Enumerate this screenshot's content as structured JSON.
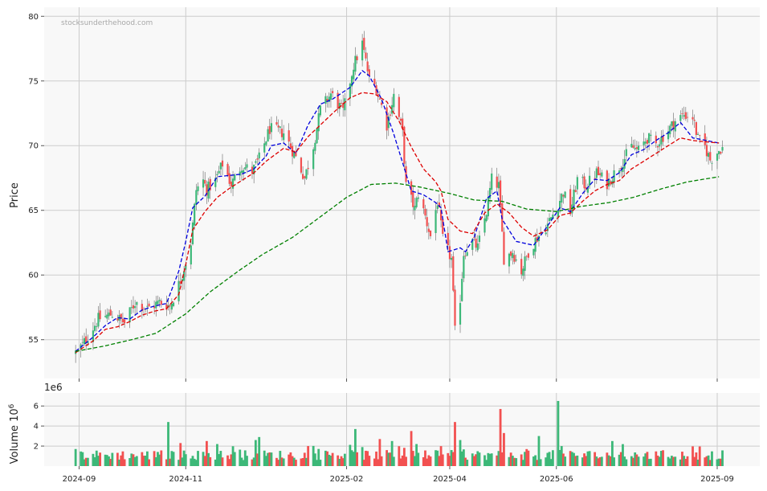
{
  "chart_data": [
    {
      "type": "candlestick",
      "watermark": "stocksunderthehood.com",
      "ylabel": "Price",
      "ylim": [
        52,
        80.7
      ],
      "y_ticks": [
        55,
        60,
        65,
        70,
        75,
        80
      ],
      "colors": {
        "up": "#3cb878",
        "down": "#f25050",
        "ma_short": "#0000dd",
        "ma_mid": "#dd0000",
        "ma_long": "#008000"
      },
      "series": [
        {
          "type": "line",
          "style": "dashed",
          "points": [
            [
              "2024-08-30",
              54.1
            ],
            [
              "2024-09-09",
              55.2
            ],
            [
              "2024-09-16",
              56.1
            ],
            [
              "2024-09-23",
              56.7
            ],
            [
              "2024-09-30",
              56.6
            ],
            [
              "2024-10-07",
              57.3
            ],
            [
              "2024-10-14",
              57.6
            ],
            [
              "2024-10-21",
              57.8
            ],
            [
              "2024-10-28",
              60.3
            ],
            [
              "2024-11-01",
              62.6
            ],
            [
              "2024-11-05",
              65.2
            ],
            [
              "2024-11-12",
              66.1
            ],
            [
              "2024-11-19",
              67.6
            ],
            [
              "2024-11-26",
              67.7
            ],
            [
              "2024-12-03",
              67.8
            ],
            [
              "2024-12-10",
              68.2
            ],
            [
              "2024-12-17",
              69.2
            ],
            [
              "2024-12-20",
              70.0
            ],
            [
              "2024-12-27",
              70.2
            ],
            [
              "2025-01-03",
              69.4
            ],
            [
              "2025-01-10",
              71.6
            ],
            [
              "2025-01-17",
              73.2
            ],
            [
              "2025-01-24",
              73.6
            ],
            [
              "2025-02-03",
              74.5
            ],
            [
              "2025-02-10",
              75.8
            ],
            [
              "2025-02-14",
              75.4
            ],
            [
              "2025-02-21",
              73.6
            ],
            [
              "2025-02-28",
              70.9
            ],
            [
              "2025-03-05",
              68.7
            ],
            [
              "2025-03-10",
              66.5
            ],
            [
              "2025-03-17",
              66.2
            ],
            [
              "2025-03-24",
              65.6
            ],
            [
              "2025-03-27",
              65.2
            ],
            [
              "2025-03-31",
              61.8
            ],
            [
              "2025-04-07",
              62.1
            ],
            [
              "2025-04-10",
              61.8
            ],
            [
              "2025-04-15",
              62.9
            ],
            [
              "2025-04-22",
              65.9
            ],
            [
              "2025-04-28",
              66.5
            ],
            [
              "2025-05-01",
              64.3
            ],
            [
              "2025-05-09",
              62.6
            ],
            [
              "2025-05-19",
              62.3
            ],
            [
              "2025-05-27",
              63.8
            ],
            [
              "2025-06-03",
              65.2
            ],
            [
              "2025-06-09",
              64.9
            ],
            [
              "2025-06-16",
              66.3
            ],
            [
              "2025-06-23",
              67.4
            ],
            [
              "2025-06-30",
              67.3
            ],
            [
              "2025-07-07",
              67.9
            ],
            [
              "2025-07-14",
              69.3
            ],
            [
              "2025-07-21",
              69.7
            ],
            [
              "2025-07-28",
              70.4
            ],
            [
              "2025-08-04",
              71.0
            ],
            [
              "2025-08-11",
              71.8
            ],
            [
              "2025-08-18",
              70.6
            ],
            [
              "2025-08-22",
              70.5
            ],
            [
              "2025-09-02",
              70.2
            ]
          ]
        },
        {
          "type": "line",
          "style": "dashed",
          "points": [
            [
              "2024-08-30",
              54.0
            ],
            [
              "2024-09-09",
              54.9
            ],
            [
              "2024-09-16",
              55.8
            ],
            [
              "2024-09-23",
              56.0
            ],
            [
              "2024-09-30",
              56.4
            ],
            [
              "2024-10-07",
              56.9
            ],
            [
              "2024-10-14",
              57.2
            ],
            [
              "2024-10-21",
              57.4
            ],
            [
              "2024-10-28",
              58.5
            ],
            [
              "2024-11-01",
              60.8
            ],
            [
              "2024-11-05",
              63.5
            ],
            [
              "2024-11-12",
              64.9
            ],
            [
              "2024-11-19",
              66.0
            ],
            [
              "2024-11-26",
              66.7
            ],
            [
              "2024-12-03",
              67.3
            ],
            [
              "2024-12-10",
              67.9
            ],
            [
              "2024-12-17",
              68.8
            ],
            [
              "2024-12-27",
              69.8
            ],
            [
              "2025-01-03",
              69.5
            ],
            [
              "2025-01-10",
              70.7
            ],
            [
              "2025-01-17",
              71.6
            ],
            [
              "2025-01-24",
              72.5
            ],
            [
              "2025-02-03",
              73.7
            ],
            [
              "2025-02-10",
              74.1
            ],
            [
              "2025-02-17",
              74.0
            ],
            [
              "2025-02-24",
              73.4
            ],
            [
              "2025-03-03",
              71.9
            ],
            [
              "2025-03-10",
              69.9
            ],
            [
              "2025-03-17",
              68.2
            ],
            [
              "2025-03-24",
              67.2
            ],
            [
              "2025-03-27",
              66.5
            ],
            [
              "2025-03-31",
              64.3
            ],
            [
              "2025-04-07",
              63.4
            ],
            [
              "2025-04-14",
              63.2
            ],
            [
              "2025-04-21",
              64.8
            ],
            [
              "2025-04-28",
              65.5
            ],
            [
              "2025-05-05",
              64.8
            ],
            [
              "2025-05-12",
              63.7
            ],
            [
              "2025-05-19",
              63.0
            ],
            [
              "2025-05-27",
              63.5
            ],
            [
              "2025-06-03",
              64.6
            ],
            [
              "2025-06-09",
              64.8
            ],
            [
              "2025-06-16",
              65.7
            ],
            [
              "2025-06-23",
              66.5
            ],
            [
              "2025-06-30",
              67.0
            ],
            [
              "2025-07-07",
              67.3
            ],
            [
              "2025-07-14",
              68.2
            ],
            [
              "2025-07-21",
              68.8
            ],
            [
              "2025-07-28",
              69.4
            ],
            [
              "2025-08-04",
              70.0
            ],
            [
              "2025-08-11",
              70.6
            ],
            [
              "2025-08-18",
              70.4
            ],
            [
              "2025-08-25",
              70.3
            ],
            [
              "2025-09-02",
              70.2
            ]
          ]
        },
        {
          "type": "line",
          "style": "dashed",
          "points": [
            [
              "2024-08-30",
              54.1
            ],
            [
              "2024-09-15",
              54.5
            ],
            [
              "2024-10-01",
              55.0
            ],
            [
              "2024-10-15",
              55.5
            ],
            [
              "2024-11-01",
              57.0
            ],
            [
              "2024-11-15",
              58.7
            ],
            [
              "2024-12-01",
              60.3
            ],
            [
              "2024-12-15",
              61.6
            ],
            [
              "2025-01-01",
              62.9
            ],
            [
              "2025-01-15",
              64.3
            ],
            [
              "2025-02-01",
              66.0
            ],
            [
              "2025-02-15",
              67.0
            ],
            [
              "2025-03-01",
              67.1
            ],
            [
              "2025-03-15",
              66.8
            ],
            [
              "2025-04-01",
              66.3
            ],
            [
              "2025-04-15",
              65.8
            ],
            [
              "2025-05-01",
              65.7
            ],
            [
              "2025-05-15",
              65.1
            ],
            [
              "2025-06-01",
              64.9
            ],
            [
              "2025-06-15",
              65.3
            ],
            [
              "2025-07-01",
              65.6
            ],
            [
              "2025-07-15",
              66.0
            ],
            [
              "2025-08-01",
              66.7
            ],
            [
              "2025-08-15",
              67.2
            ],
            [
              "2025-09-02",
              67.6
            ]
          ]
        }
      ],
      "anchors": [
        [
          "2024-08-30",
          54.0
        ],
        [
          "2024-09-03",
          54.6
        ],
        [
          "2024-09-12",
          56.6
        ],
        [
          "2024-09-20",
          57.0
        ],
        [
          "2024-09-27",
          56.3
        ],
        [
          "2024-10-03",
          57.9
        ],
        [
          "2024-10-10",
          57.4
        ],
        [
          "2024-10-17",
          57.9
        ],
        [
          "2024-10-23",
          57.6
        ],
        [
          "2024-10-29",
          59.6
        ],
        [
          "2024-11-04",
          62.5
        ],
        [
          "2024-11-07",
          66.6
        ],
        [
          "2024-11-11",
          67.3
        ],
        [
          "2024-11-13",
          66.6
        ],
        [
          "2024-11-18",
          67.3
        ],
        [
          "2024-11-22",
          68.6
        ],
        [
          "2024-11-27",
          67.0
        ],
        [
          "2024-12-03",
          68.5
        ],
        [
          "2024-12-09",
          68.0
        ],
        [
          "2024-12-13",
          69.0
        ],
        [
          "2024-12-19",
          71.3
        ],
        [
          "2024-12-27",
          71.0
        ],
        [
          "2025-01-03",
          69.1
        ],
        [
          "2025-01-08",
          67.5
        ],
        [
          "2025-01-13",
          70.0
        ],
        [
          "2025-01-17",
          72.8
        ],
        [
          "2025-01-23",
          74.0
        ],
        [
          "2025-01-30",
          72.6
        ],
        [
          "2025-02-05",
          76.2
        ],
        [
          "2025-02-10",
          77.9
        ],
        [
          "2025-02-14",
          75.1
        ],
        [
          "2025-02-18",
          74.5
        ],
        [
          "2025-02-24",
          71.6
        ],
        [
          "2025-02-28",
          73.9
        ],
        [
          "2025-03-05",
          71.0
        ],
        [
          "2025-03-07",
          66.9
        ],
        [
          "2025-03-12",
          65.1
        ],
        [
          "2025-03-14",
          66.3
        ],
        [
          "2025-03-18",
          64.5
        ],
        [
          "2025-03-21",
          63.0
        ],
        [
          "2025-03-25",
          65.7
        ],
        [
          "2025-03-28",
          62.8
        ],
        [
          "2025-04-02",
          61.2
        ],
        [
          "2025-04-04",
          55.6
        ],
        [
          "2025-04-07",
          58.2
        ],
        [
          "2025-04-09",
          61.7
        ],
        [
          "2025-04-14",
          62.6
        ],
        [
          "2025-04-17",
          62.1
        ],
        [
          "2025-04-22",
          64.9
        ],
        [
          "2025-04-25",
          67.4
        ],
        [
          "2025-04-29",
          66.9
        ],
        [
          "2025-05-02",
          61.3
        ],
        [
          "2025-05-07",
          61.8
        ],
        [
          "2025-05-12",
          60.3
        ],
        [
          "2025-05-16",
          61.8
        ],
        [
          "2025-05-21",
          62.9
        ],
        [
          "2025-05-27",
          63.9
        ],
        [
          "2025-06-02",
          65.5
        ],
        [
          "2025-06-05",
          66.4
        ],
        [
          "2025-06-09",
          64.9
        ],
        [
          "2025-06-13",
          67.4
        ],
        [
          "2025-06-18",
          66.9
        ],
        [
          "2025-06-24",
          67.9
        ],
        [
          "2025-06-30",
          67.1
        ],
        [
          "2025-07-07",
          68.4
        ],
        [
          "2025-07-14",
          69.9
        ],
        [
          "2025-07-18",
          69.6
        ],
        [
          "2025-07-23",
          70.6
        ],
        [
          "2025-07-28",
          70.1
        ],
        [
          "2025-08-04",
          71.2
        ],
        [
          "2025-08-08",
          71.9
        ],
        [
          "2025-08-13",
          72.4
        ],
        [
          "2025-08-18",
          72.2
        ],
        [
          "2025-08-21",
          70.5
        ],
        [
          "2025-08-25",
          69.9
        ],
        [
          "2025-08-28",
          68.9
        ],
        [
          "2025-09-03",
          69.8
        ]
      ]
    },
    {
      "type": "bar",
      "ylabel": "Volume  10",
      "ylabel_exp": "6",
      "offset_text": "1e6",
      "ylim": [
        0,
        7.3
      ],
      "y_ticks": [
        2,
        4,
        6
      ],
      "colors": {
        "up": "#3cb878",
        "down": "#f25050"
      },
      "spikes": [
        [
          "2024-10-22",
          4.4
        ],
        [
          "2024-10-29",
          2.3
        ],
        [
          "2024-11-13",
          2.5
        ],
        [
          "2024-11-19",
          2.2
        ],
        [
          "2024-12-11",
          2.6
        ],
        [
          "2024-12-13",
          2.9
        ],
        [
          "2025-01-10",
          2.0
        ],
        [
          "2025-02-06",
          3.7
        ],
        [
          "2025-02-10",
          1.9
        ],
        [
          "2025-02-20",
          2.7
        ],
        [
          "2025-02-27",
          2.5
        ],
        [
          "2025-03-10",
          3.5
        ],
        [
          "2025-03-13",
          2.2
        ],
        [
          "2025-04-04",
          4.4
        ],
        [
          "2025-04-07",
          2.6
        ],
        [
          "2025-04-30",
          5.7
        ],
        [
          "2025-05-02",
          3.3
        ],
        [
          "2025-05-22",
          3.0
        ],
        [
          "2025-06-02",
          6.5
        ],
        [
          "2025-06-04",
          2.0
        ],
        [
          "2025-07-03",
          2.5
        ]
      ],
      "x_ticks": [
        "2024-09",
        "2024-11",
        "2025-02",
        "2025-04",
        "2025-06",
        "2025-09"
      ]
    }
  ]
}
